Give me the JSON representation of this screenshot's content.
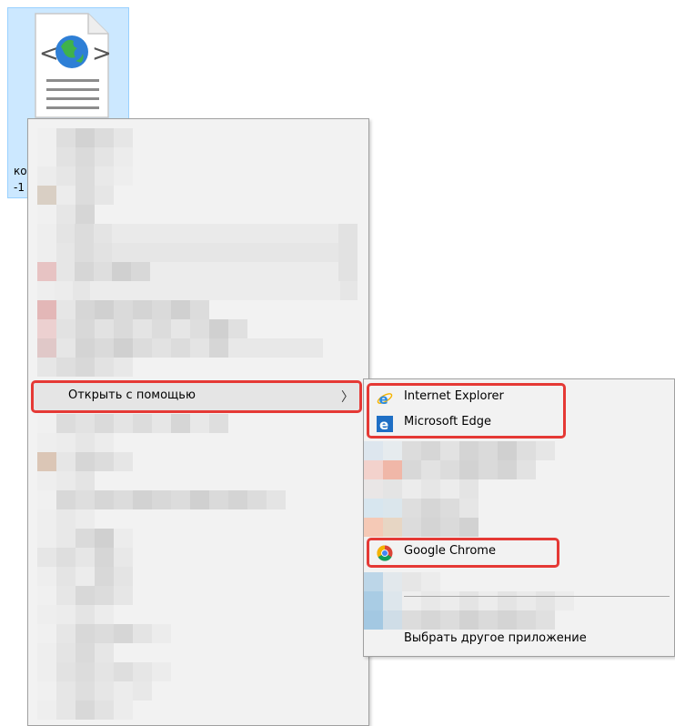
{
  "file": {
    "label_line1": "ко",
    "label_line2": "-1",
    "icon": "html-globe-file-icon"
  },
  "context_menu": {
    "open_with_label": "Открыть с помощью",
    "submenu_arrow": "〉"
  },
  "open_with_submenu": {
    "items": [
      {
        "label": "Internet Explorer",
        "icon": "internet-explorer-icon"
      },
      {
        "label": "Microsoft Edge",
        "icon": "microsoft-edge-icon"
      },
      {
        "label": "Google Chrome",
        "icon": "google-chrome-icon"
      }
    ],
    "choose_other_label": "Выбрать другое приложение"
  },
  "colors": {
    "highlight": "#e53935",
    "selection": "#cce8ff",
    "menu_bg": "#f2f2f2"
  }
}
